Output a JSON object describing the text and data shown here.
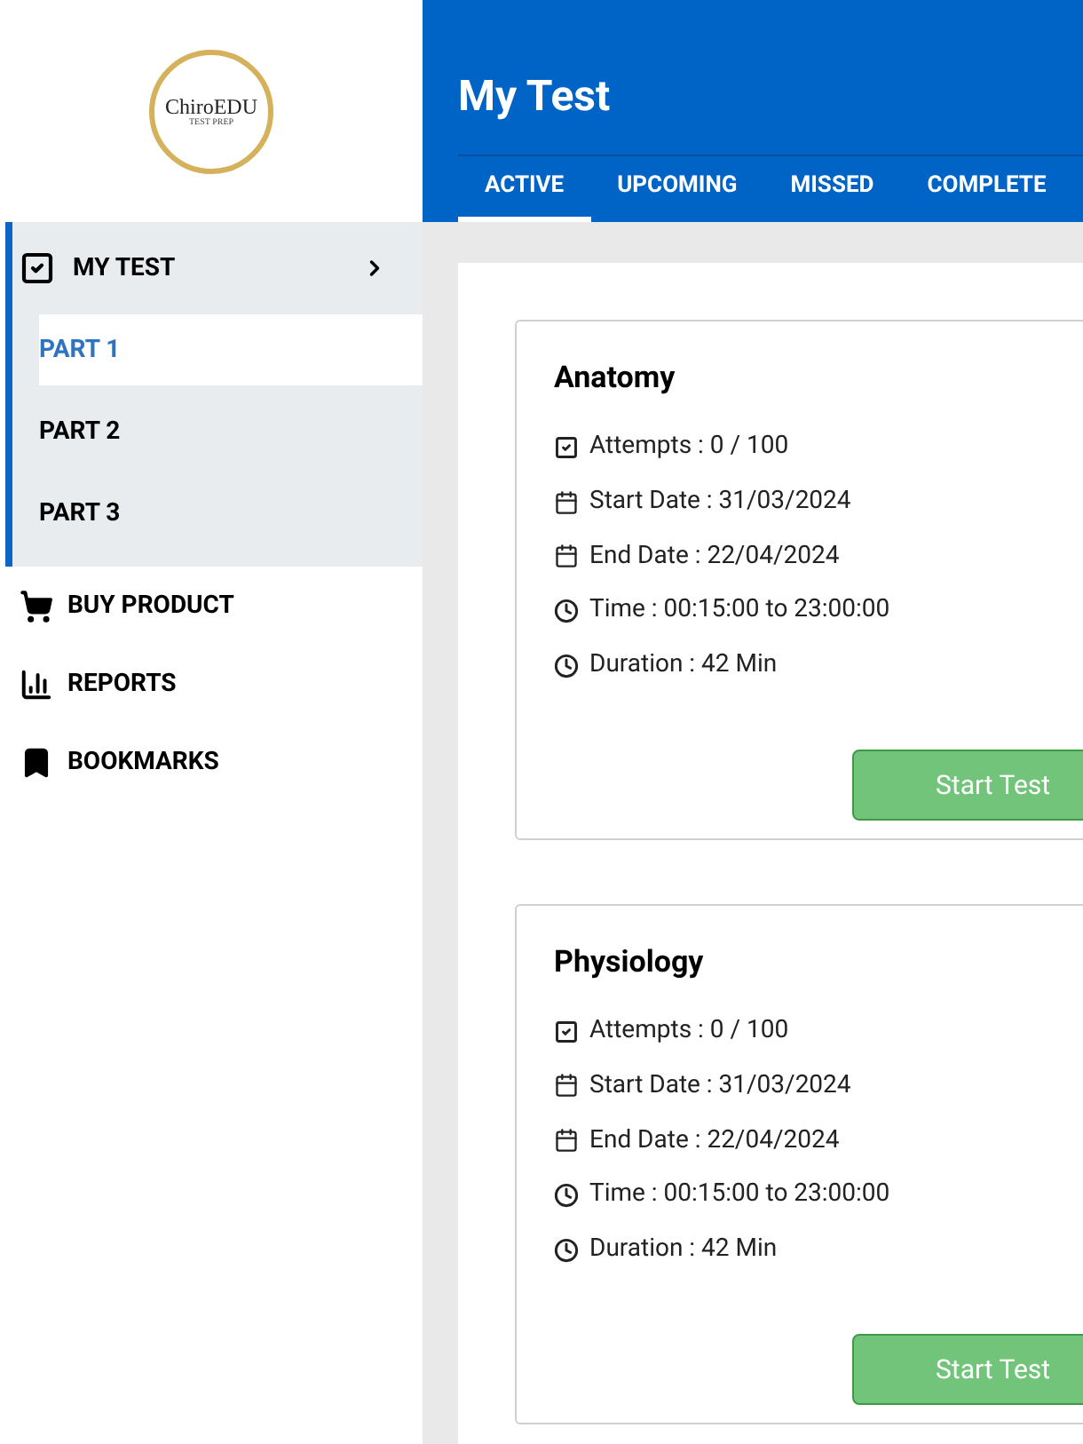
{
  "logo": {
    "name": "ChiroEDU",
    "tagline": "TEST PREP"
  },
  "sidebar": {
    "items": [
      {
        "kind": "tests",
        "label": "MY TEST",
        "expanded": true,
        "children": [
          {
            "label": "PART 1",
            "selected": true
          },
          {
            "label": "PART 2",
            "selected": false
          },
          {
            "label": "PART 3",
            "selected": false
          }
        ]
      },
      {
        "kind": "shop",
        "label": "BUY PRODUCT"
      },
      {
        "kind": "reports",
        "label": "REPORTS"
      },
      {
        "kind": "bookmarks",
        "label": "BOOKMARKS"
      }
    ]
  },
  "header": {
    "title": "My Test"
  },
  "tabs": [
    {
      "label": "ACTIVE",
      "selected": true
    },
    {
      "label": "UPCOMING",
      "selected": false
    },
    {
      "label": "MISSED",
      "selected": false
    },
    {
      "label": "COMPLETE",
      "selected": false
    }
  ],
  "tests": [
    {
      "title": "Anatomy",
      "details": [
        {
          "kind": "attempts",
          "text": "Attempts : 0 / 100"
        },
        {
          "kind": "date",
          "text": "Start Date : 31/03/2024"
        },
        {
          "kind": "date",
          "text": "End Date : 22/04/2024"
        },
        {
          "kind": "time",
          "text": "Time : 00:15:00 to 23:00:00"
        },
        {
          "kind": "time",
          "text": "Duration : 42 Min"
        }
      ],
      "button": "Start Test"
    },
    {
      "title": "Physiology",
      "details": [
        {
          "kind": "attempts",
          "text": "Attempts : 0 / 100"
        },
        {
          "kind": "date",
          "text": "Start Date : 31/03/2024"
        },
        {
          "kind": "date",
          "text": "End Date : 22/04/2024"
        },
        {
          "kind": "time",
          "text": "Time : 00:15:00 to 23:00:00"
        },
        {
          "kind": "time",
          "text": "Duration : 42 Min"
        }
      ],
      "button": "Start Test"
    }
  ]
}
